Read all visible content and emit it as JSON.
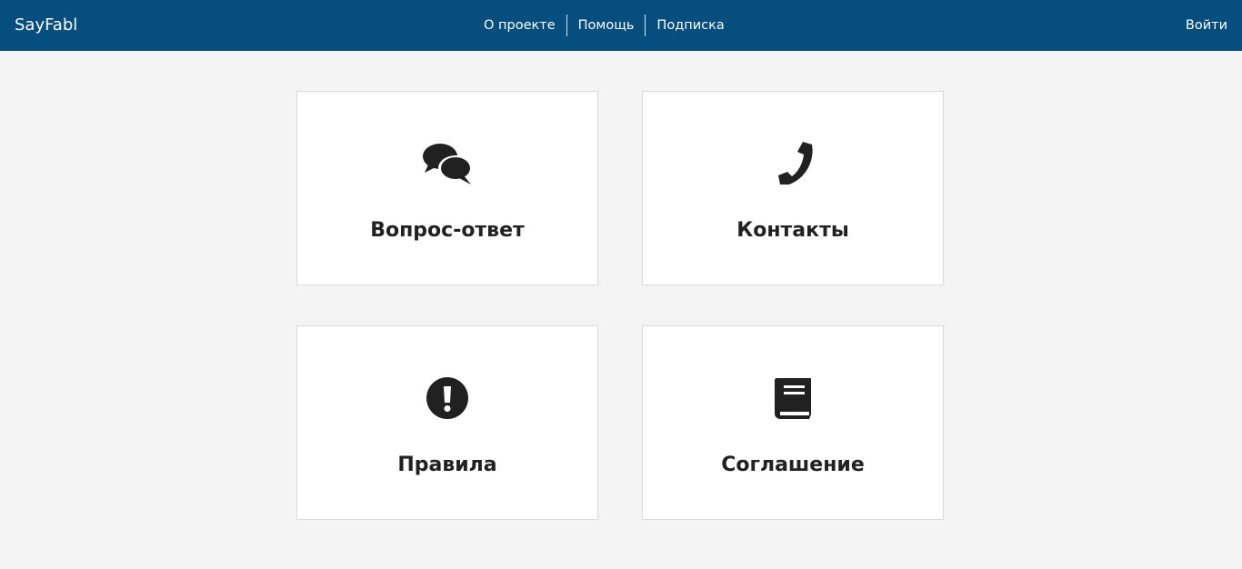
{
  "navbar": {
    "brand": "SayFabl",
    "links": [
      {
        "label": "О проекте"
      },
      {
        "label": "Помощь"
      },
      {
        "label": "Подписка"
      }
    ],
    "login_label": "Войти",
    "background_color": "#054e7e"
  },
  "cards": [
    {
      "label": "Вопрос-ответ",
      "icon": "comments-icon"
    },
    {
      "label": "Контакты",
      "icon": "phone-icon"
    },
    {
      "label": "Правила",
      "icon": "exclamation-circle-icon"
    },
    {
      "label": "Соглашение",
      "icon": "book-icon"
    }
  ],
  "colors": {
    "page_background": "#f4f4f4",
    "card_background": "#ffffff",
    "card_border": "#dadada",
    "text": "#212121"
  }
}
